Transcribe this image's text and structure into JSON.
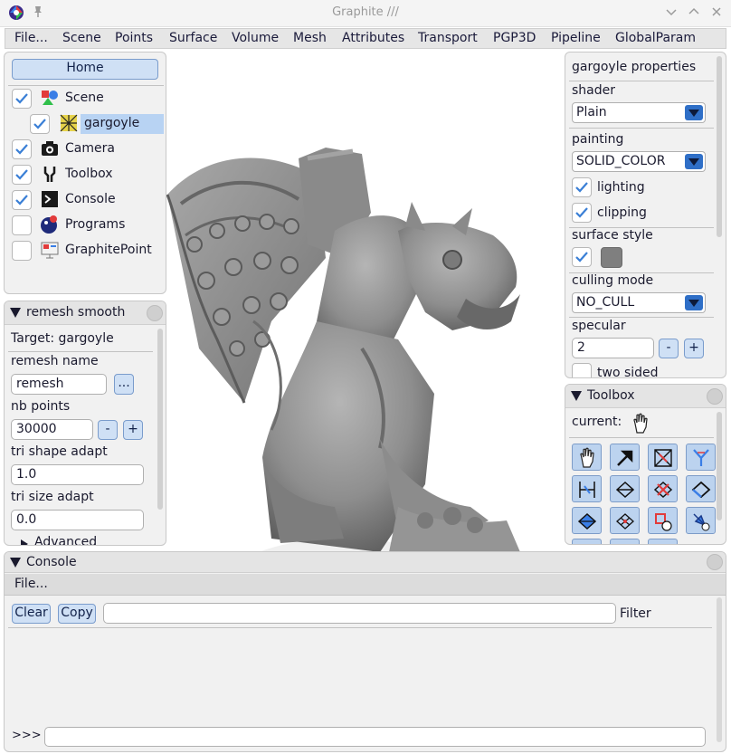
{
  "window": {
    "title": "Graphite ///"
  },
  "menu": {
    "items": [
      "File...",
      "Scene",
      "Points",
      "Surface",
      "Volume",
      "Mesh",
      "Attributes",
      "Transport",
      "PGP3D",
      "Pipeline",
      "GlobalParam"
    ]
  },
  "scene_panel": {
    "home_label": "Home",
    "items": [
      {
        "label": "Scene",
        "checked": true,
        "icon": "scene-icon"
      },
      {
        "label": "gargoyle",
        "checked": true,
        "icon": "mesh-object-icon",
        "selected": true
      },
      {
        "label": "Camera",
        "checked": true,
        "icon": "camera-icon"
      },
      {
        "label": "Toolbox",
        "checked": true,
        "icon": "toolbox-icon"
      },
      {
        "label": "Console",
        "checked": true,
        "icon": "console-icon"
      },
      {
        "label": "Programs",
        "checked": false,
        "icon": "programs-icon"
      },
      {
        "label": "GraphitePoint",
        "checked": false,
        "icon": "graphitepoint-icon"
      }
    ]
  },
  "remesh_panel": {
    "title": "remesh smooth",
    "target": "Target: gargoyle",
    "remesh_name_label": "remesh name",
    "remesh_name_value": "remesh",
    "browse_label": "...",
    "nb_points_label": "nb points",
    "nb_points_value": "30000",
    "minus": "-",
    "plus": "+",
    "tri_shape_label": "tri shape adapt",
    "tri_shape_value": "1.0",
    "tri_size_label": "tri size adapt",
    "tri_size_value": "0.0",
    "advanced_label": "Advanced"
  },
  "properties_panel": {
    "title": "gargoyle properties",
    "shader_label": "shader",
    "shader_value": "Plain",
    "painting_label": "painting",
    "painting_value": "SOLID_COLOR",
    "lighting_label": "lighting",
    "lighting_checked": true,
    "clipping_label": "clipping",
    "clipping_checked": true,
    "surface_style_label": "surface style",
    "surface_style_checked": true,
    "surface_color": "#7f7f7f",
    "culling_label": "culling mode",
    "culling_value": "NO_CULL",
    "specular_label": "specular",
    "specular_value": "2",
    "minus": "-",
    "plus": "+",
    "two_sided_label": "two sided",
    "two_sided_checked": false
  },
  "toolbox_panel": {
    "title": "Toolbox",
    "current_label": "current:",
    "current_tool_icon": "hand-pointer-icon",
    "tools": [
      "hand-pointer-icon",
      "arrow-pointer-icon",
      "mesh-edit-icon",
      "mesh-zip-icon",
      "split-edge-icon",
      "create-facet-icon",
      "delete-facet-icon",
      "edit-border-icon",
      "select-facet-icon",
      "mesh-grid-icon",
      "remove-component-icon",
      "move-vertex-icon"
    ]
  },
  "console_panel": {
    "title": "Console",
    "file_menu": "File...",
    "clear_label": "Clear",
    "copy_label": "Copy",
    "filter_value": "",
    "filter_label": "Filter",
    "prompt": ">>>",
    "command_value": ""
  },
  "colors": {
    "accent": "#2f6fc7",
    "button_bg": "#cfe0f5",
    "selected_item": "#b8d3f3",
    "model_gray": "#8f8f8f"
  }
}
